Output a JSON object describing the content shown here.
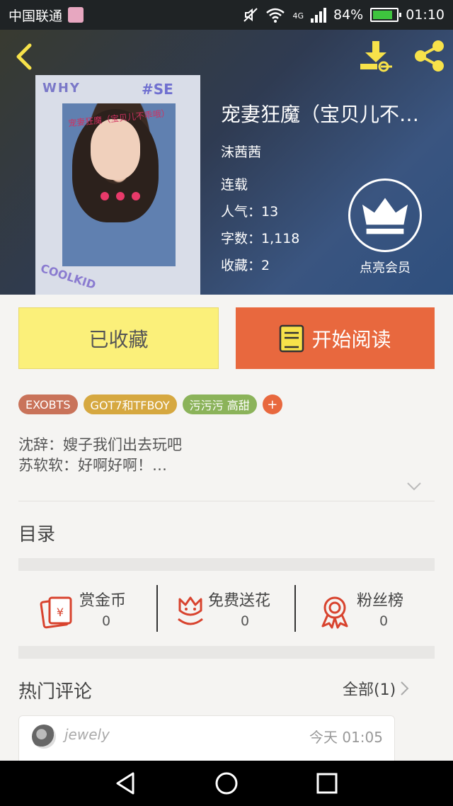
{
  "status_bar": {
    "carrier": "中国联通",
    "network": "4G",
    "battery_text": "84%",
    "battery_level": 0.84,
    "time": "01:10"
  },
  "book": {
    "title": "宠妻狂魔（宝贝儿不…",
    "author": "沫茜茜",
    "status": "连载",
    "popularity": "人气：13",
    "word_count": "字数：1,118",
    "favorites": "收藏：2",
    "cover_texts": {
      "top_left": "WHY",
      "top_right": "#SE",
      "bottom": "COOLKID",
      "tagline": "宠妻狂魔（宝贝儿不乖哦）"
    }
  },
  "vip": {
    "label": "点亮会员"
  },
  "actions": {
    "favorite_label": "已收藏",
    "read_label": "开始阅读"
  },
  "tags": [
    {
      "label": "EXOBTS",
      "color": "#c9735a"
    },
    {
      "label": "GOT7和TFBOY",
      "color": "#d6a840"
    },
    {
      "label": "污污污  高甜",
      "color": "#8bb35a"
    }
  ],
  "tag_add_label": "+",
  "summary": {
    "line1": "沈辞：嫂子我们出去玩吧",
    "line2": "苏软软：好啊好啊！…"
  },
  "catalog": {
    "title": "目录"
  },
  "stats": [
    {
      "label": "赏金币",
      "value": "0"
    },
    {
      "label": "免费送花",
      "value": "0"
    },
    {
      "label": "粉丝榜",
      "value": "0"
    }
  ],
  "comments": {
    "title": "热门评论",
    "all_label": "全部(1)",
    "items": [
      {
        "user": "jewely",
        "time": "今天 01:05"
      }
    ]
  },
  "colors": {
    "accent": "#e8683e",
    "favorite_bg": "#fbf07a",
    "icon_red": "#d8432e"
  }
}
